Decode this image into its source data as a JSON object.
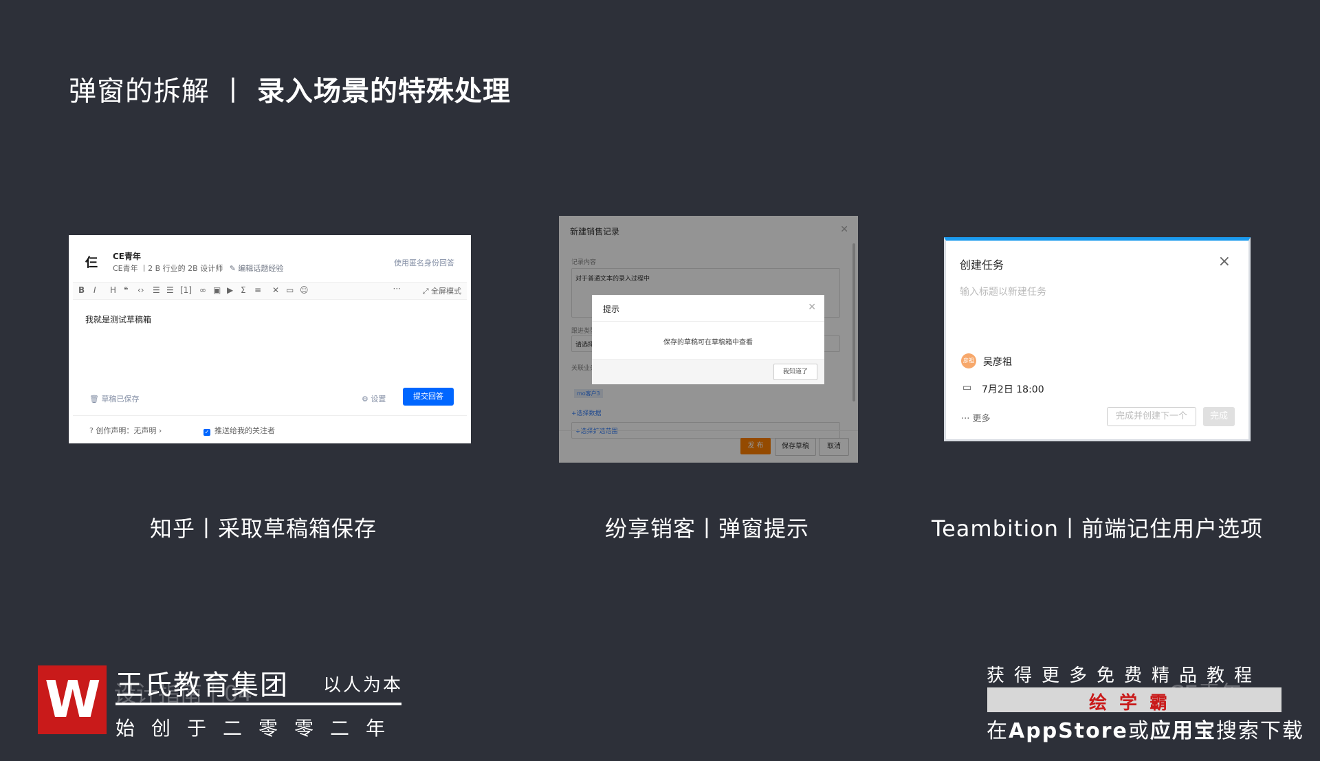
{
  "slide": {
    "title_left": "弹窗的拆解",
    "title_sep": "丨",
    "title_right": "录入场景的特殊处理"
  },
  "zhihu": {
    "logo": "仨",
    "name": "CE青年",
    "meta": "CE青年 丨2 B 行业的 2B 设计师",
    "edit_link": "编辑话题经验",
    "anon_answer": "使用匿名身份回答",
    "toolbar_more": "···",
    "toolbar_fullscreen": "全屏模式",
    "content": "我就是测试草稿箱",
    "draft_saved": "草稿已保存",
    "settings": "设置",
    "submit": "提交回答",
    "declaration": "创作声明：无声明",
    "push_followers": "推送给我的关注者",
    "caption": "知乎丨采取草稿箱保存"
  },
  "fenxiang": {
    "bg_title": "新建销售记录",
    "record_label": "记录内容",
    "record_text": "对于普通文本的录入过程中",
    "type_label": "跟进类型",
    "type_placeholder": "请选择",
    "related_label": "关联业务",
    "customer_tag": "mo客户3",
    "select_data": "+选择数据",
    "select_scope": "+选择扩选范围",
    "publish": "发 布",
    "save_draft": "保存草稿",
    "cancel": "取消",
    "dialog_title": "提示",
    "dialog_message": "保存的草稿可在草稿箱中查看",
    "dialog_ok": "我知道了",
    "caption": "纷享销客丨弹窗提示"
  },
  "teambition": {
    "title": "创建任务",
    "placeholder": "输入标题以新建任务",
    "avatar_text": "彦祖",
    "user": "吴彦祖",
    "date": "7月2日 18:00",
    "more": "更多",
    "create_next": "完成并创建下一个",
    "done": "完成",
    "caption": "Teambition丨前端记住用户选项"
  },
  "watermark": {
    "logo_letter": "W",
    "company": "王氏教育集团",
    "motto": "以人为本",
    "founded": "始创于二零零二年",
    "ghost_left": "设计指南丨04",
    "ghost_right": "CE青年",
    "promo_line1": "获得更多免费精品教程",
    "promo_brand": "绘学霸",
    "promo_prefix": "在",
    "promo_appstore": "AppStore",
    "promo_or": "或",
    "promo_yyb": "应用宝",
    "promo_suffix": "搜索下载"
  },
  "colors": {
    "background": "#2d3039",
    "zhihu_blue": "#0066ff",
    "fenxiang_orange": "#ff8000",
    "teambition_blue": "#1b9aee",
    "brand_red": "#c91a1a"
  }
}
